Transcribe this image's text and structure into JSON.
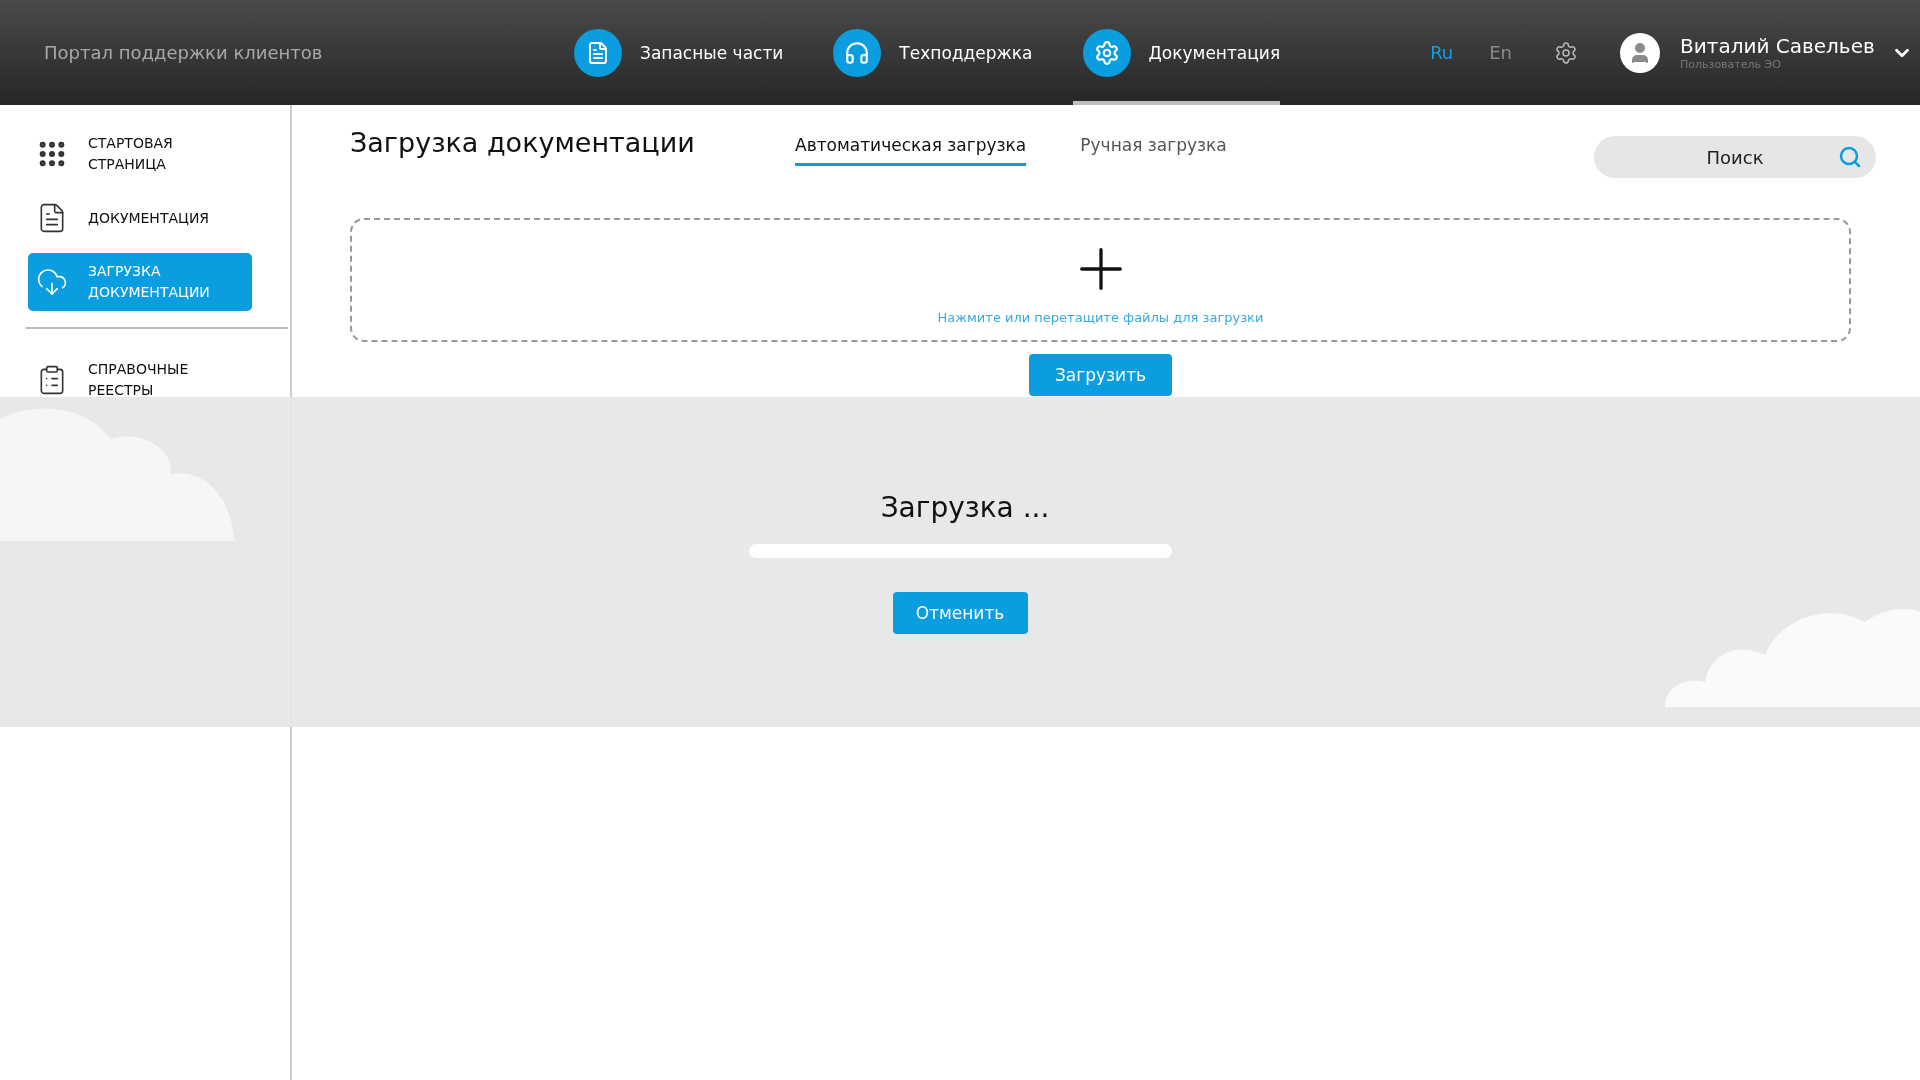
{
  "header": {
    "title": "Портал поддержки клиентов",
    "nav": [
      {
        "label": "Запасные части",
        "kind": "document",
        "selected": false
      },
      {
        "label": "Техподдержка",
        "kind": "headset",
        "selected": false
      },
      {
        "label": "Документация",
        "kind": "gear",
        "selected": true
      }
    ],
    "languages": [
      {
        "label": "Ru",
        "selected": true
      },
      {
        "label": "En",
        "selected": false
      }
    ],
    "user": {
      "name": "Виталий Савельев",
      "role": "Пользователь ЭО"
    }
  },
  "sidebar": {
    "items": [
      {
        "label": "СТАРТОВАЯ СТРАНИЦА",
        "kind": "grid",
        "selected": false,
        "divider_before": false
      },
      {
        "label": "ДОКУМЕНТАЦИЯ",
        "kind": "document",
        "selected": false,
        "divider_before": false
      },
      {
        "label": "ЗАГРУЗКА ДОКУМЕНТАЦИИ",
        "kind": "cloud",
        "selected": true,
        "divider_before": false
      },
      {
        "label": "СПРАВОЧНЫЕ РЕЕСТРЫ",
        "kind": "checklist",
        "selected": false,
        "divider_before": true
      }
    ]
  },
  "page": {
    "title": "Загрузка документации",
    "tabs": [
      {
        "label": "Автоматическая загрузка",
        "selected": true
      },
      {
        "label": "Ручная загрузка",
        "selected": false
      }
    ],
    "search": {
      "placeholder": "Поиск"
    },
    "dropzone": {
      "hint": "Нажмите или перетащите файлы для загрузки"
    },
    "upload_button": "Загрузить"
  },
  "dialog": {
    "title": "Загрузка ...",
    "level": 0,
    "cancel": "Отменить"
  }
}
